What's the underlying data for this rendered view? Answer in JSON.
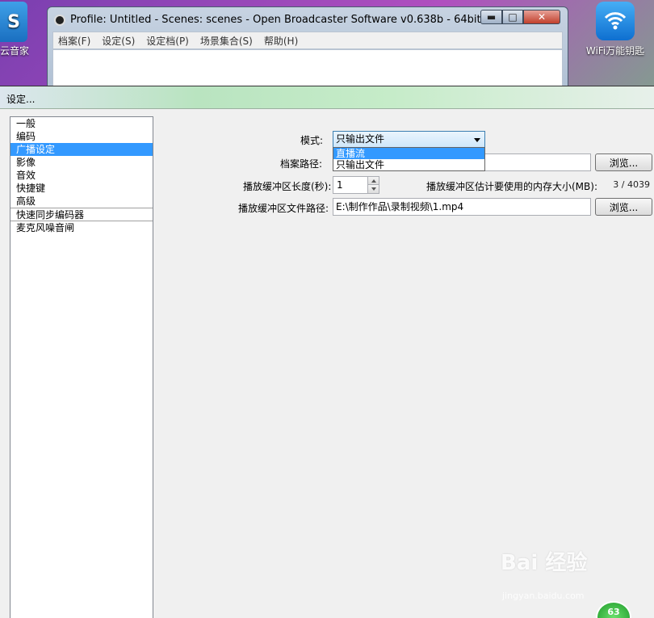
{
  "desktop": {
    "left_icon_label": "云音家",
    "left_icon_glyph": "S",
    "wifi_icon_label": "WiFi万能钥匙"
  },
  "obs": {
    "title": "Profile: Untitled - Scenes: scenes - Open Broadcaster Software v0.638b - 64bit",
    "window_buttons": {
      "minimize": "▬",
      "maximize": "□",
      "close": "✕"
    },
    "menu": [
      "档案(F)",
      "设定(S)",
      "设定档(P)",
      "场景集合(S)",
      "帮助(H)"
    ]
  },
  "settings": {
    "title": "设定...",
    "categories": [
      {
        "label": "一般",
        "selected": false
      },
      {
        "label": "编码",
        "selected": false
      },
      {
        "label": "广播设定",
        "selected": true
      },
      {
        "label": "影像",
        "selected": false
      },
      {
        "label": "音效",
        "selected": false
      },
      {
        "label": "快捷键",
        "selected": false
      },
      {
        "label": "高级",
        "selected": false
      },
      {
        "label": "快速同步编码器",
        "selected": false
      },
      {
        "label": "麦克风噪音闸",
        "selected": false
      }
    ],
    "mode": {
      "label": "模式:",
      "value": "只输出文件",
      "options": [
        "直播流",
        "只输出文件"
      ],
      "highlighted": "直播流"
    },
    "archive_path": {
      "label": "档案路径:",
      "value": ""
    },
    "browse_label": "浏览...",
    "buffer_length": {
      "label": "播放缓冲区长度(秒):",
      "value": "1"
    },
    "buffer_memory": {
      "label": "播放缓冲区估计要使用的内存大小(MB):",
      "value": "3 / 4039"
    },
    "buffer_file_path": {
      "label": "播放缓冲区文件路径:",
      "value": "E:\\制作作品\\录制视频\\1.mp4"
    }
  },
  "watermark": {
    "text": "Bai 经验",
    "url": "jingyan.baidu.com"
  },
  "badge": {
    "text": "63"
  },
  "colors": {
    "selection": "#3399ff",
    "dialog_bg": "#f0f0f0",
    "close_button": "#c1402c"
  }
}
